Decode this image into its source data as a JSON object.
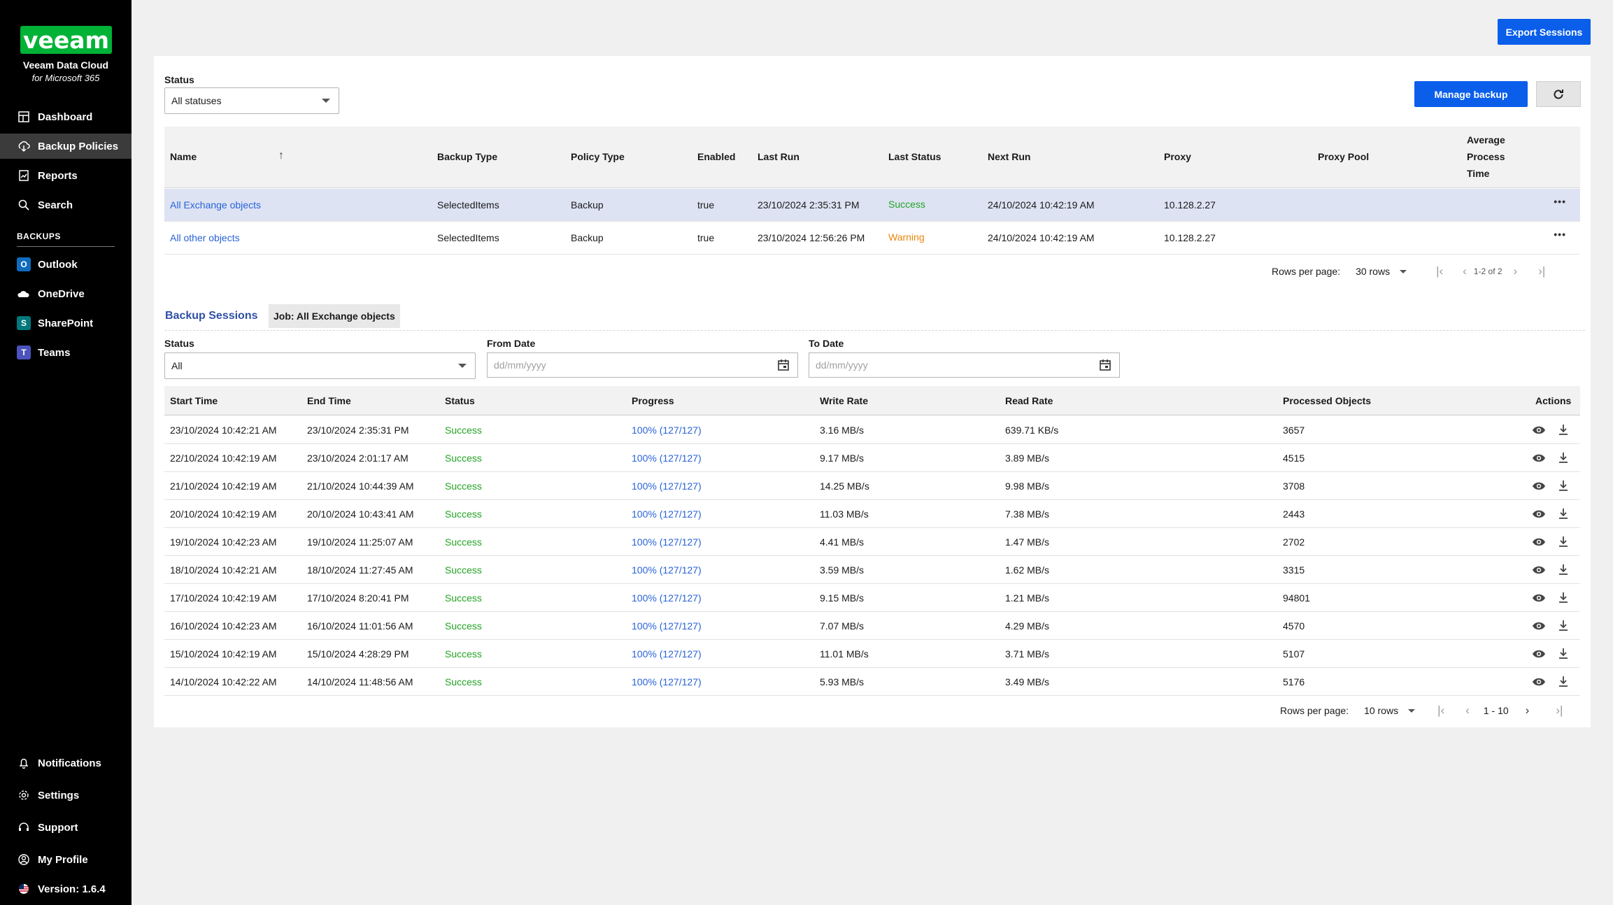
{
  "brand": {
    "logo_text": "veeam",
    "title": "Veeam Data Cloud",
    "subtitle": "for Microsoft 365",
    "accent": "#00b336"
  },
  "sidebar": {
    "items": [
      {
        "label": "Dashboard",
        "icon": "dashboard-icon"
      },
      {
        "label": "Backup Policies",
        "icon": "backup-policies-icon",
        "active": true
      },
      {
        "label": "Reports",
        "icon": "reports-icon"
      },
      {
        "label": "Search",
        "icon": "search-icon"
      }
    ],
    "backups_heading": "BACKUPS",
    "backups": [
      {
        "label": "Outlook",
        "icon": "outlook-icon"
      },
      {
        "label": "OneDrive",
        "icon": "onedrive-icon"
      },
      {
        "label": "SharePoint",
        "icon": "sharepoint-icon"
      },
      {
        "label": "Teams",
        "icon": "teams-icon"
      }
    ],
    "bottom": [
      {
        "label": "Notifications",
        "icon": "bell-icon"
      },
      {
        "label": "Settings",
        "icon": "gear-icon"
      },
      {
        "label": "Support",
        "icon": "headset-icon"
      },
      {
        "label": "My Profile",
        "icon": "user-icon"
      },
      {
        "label": "Version: 1.6.4",
        "icon": "us-flag-icon"
      }
    ]
  },
  "toolbar": {
    "export_label": "Export Sessions",
    "manage_label": "Manage backup",
    "primary_color": "#0a5eea"
  },
  "policies": {
    "status_label": "Status",
    "status_value": "All statuses",
    "columns": [
      "Name",
      "Backup Type",
      "Policy Type",
      "Enabled",
      "Last Run",
      "Last Status",
      "Next Run",
      "Proxy",
      "Proxy Pool",
      "Average Process Time"
    ],
    "avg_col_lines": [
      "Average",
      "Process",
      "Time"
    ],
    "rows": [
      {
        "name": "All Exchange objects",
        "backup_type": "SelectedItems",
        "policy_type": "Backup",
        "enabled": "true",
        "last_run": "23/10/2024 2:35:31 PM",
        "last_status": "Success",
        "next_run": "24/10/2024 10:42:19 AM",
        "proxy": "10.128.2.27",
        "proxy_pool": "",
        "avg": ""
      },
      {
        "name": "All other objects",
        "backup_type": "SelectedItems",
        "policy_type": "Backup",
        "enabled": "true",
        "last_run": "23/10/2024 12:56:26 PM",
        "last_status": "Warning",
        "next_run": "24/10/2024 10:42:19 AM",
        "proxy": "10.128.2.27",
        "proxy_pool": "",
        "avg": ""
      }
    ],
    "rows_per_page_label": "Rows per page:",
    "rows_per_page_value": "30 rows",
    "range": "1-2 of 2"
  },
  "sessions": {
    "tab_label": "Backup Sessions",
    "job_chip": "Job: All Exchange objects",
    "status_label": "Status",
    "status_value": "All",
    "from_label": "From Date",
    "to_label": "To Date",
    "date_placeholder": "dd/mm/yyyy",
    "columns": [
      "Start Time",
      "End Time",
      "Status",
      "Progress",
      "Write Rate",
      "Read Rate",
      "Processed Objects",
      "Actions"
    ],
    "rows": [
      {
        "start": "23/10/2024 10:42:21 AM",
        "end": "23/10/2024 2:35:31 PM",
        "status": "Success",
        "progress": "100% (127/127)",
        "write": "3.16 MB/s",
        "read": "639.71 KB/s",
        "objects": "3657"
      },
      {
        "start": "22/10/2024 10:42:19 AM",
        "end": "23/10/2024 2:01:17 AM",
        "status": "Success",
        "progress": "100% (127/127)",
        "write": "9.17 MB/s",
        "read": "3.89 MB/s",
        "objects": "4515"
      },
      {
        "start": "21/10/2024 10:42:19 AM",
        "end": "21/10/2024 10:44:39 AM",
        "status": "Success",
        "progress": "100% (127/127)",
        "write": "14.25 MB/s",
        "read": "9.98 MB/s",
        "objects": "3708"
      },
      {
        "start": "20/10/2024 10:42:19 AM",
        "end": "20/10/2024 10:43:41 AM",
        "status": "Success",
        "progress": "100% (127/127)",
        "write": "11.03 MB/s",
        "read": "7.38 MB/s",
        "objects": "2443"
      },
      {
        "start": "19/10/2024 10:42:23 AM",
        "end": "19/10/2024 11:25:07 AM",
        "status": "Success",
        "progress": "100% (127/127)",
        "write": "4.41 MB/s",
        "read": "1.47 MB/s",
        "objects": "2702"
      },
      {
        "start": "18/10/2024 10:42:21 AM",
        "end": "18/10/2024 11:27:45 AM",
        "status": "Success",
        "progress": "100% (127/127)",
        "write": "3.59 MB/s",
        "read": "1.62 MB/s",
        "objects": "3315"
      },
      {
        "start": "17/10/2024 10:42:19 AM",
        "end": "17/10/2024 8:20:41 PM",
        "status": "Success",
        "progress": "100% (127/127)",
        "write": "9.15 MB/s",
        "read": "1.21 MB/s",
        "objects": "94801"
      },
      {
        "start": "16/10/2024 10:42:23 AM",
        "end": "16/10/2024 11:01:56 AM",
        "status": "Success",
        "progress": "100% (127/127)",
        "write": "7.07 MB/s",
        "read": "4.29 MB/s",
        "objects": "4570"
      },
      {
        "start": "15/10/2024 10:42:19 AM",
        "end": "15/10/2024 4:28:29 PM",
        "status": "Success",
        "progress": "100% (127/127)",
        "write": "11.01 MB/s",
        "read": "3.71 MB/s",
        "objects": "5107"
      },
      {
        "start": "14/10/2024 10:42:22 AM",
        "end": "14/10/2024 11:48:56 AM",
        "status": "Success",
        "progress": "100% (127/127)",
        "write": "5.93 MB/s",
        "read": "3.49 MB/s",
        "objects": "5176"
      }
    ],
    "rows_per_page_label": "Rows per page:",
    "rows_per_page_value": "10 rows",
    "range": "1 - 10"
  }
}
